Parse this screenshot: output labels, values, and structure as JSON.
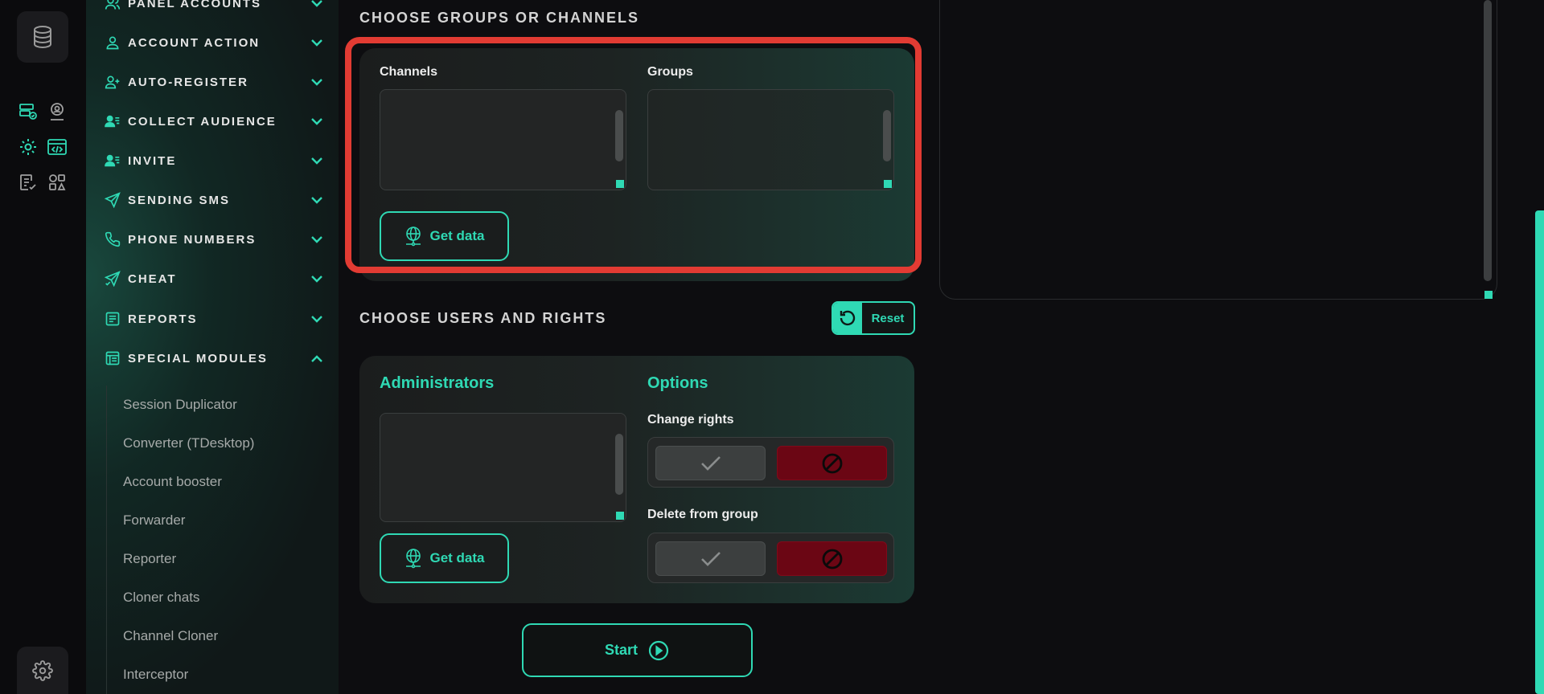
{
  "sidebar": {
    "items": [
      {
        "label": "PANEL ACCOUNTS",
        "icon": "users-icon",
        "expanded": false
      },
      {
        "label": "ACCOUNT ACTION",
        "icon": "user-icon",
        "expanded": false
      },
      {
        "label": "AUTO-REGISTER",
        "icon": "user-plus-icon",
        "expanded": false
      },
      {
        "label": "COLLECT AUDIENCE",
        "icon": "user-list-icon",
        "expanded": false
      },
      {
        "label": "INVITE",
        "icon": "user-list-icon",
        "expanded": false
      },
      {
        "label": "SENDING SMS",
        "icon": "send-icon",
        "expanded": false
      },
      {
        "label": "PHONE NUMBERS",
        "icon": "phone-icon",
        "expanded": false
      },
      {
        "label": "CHEAT",
        "icon": "send-check-icon",
        "expanded": false
      },
      {
        "label": "REPORTS",
        "icon": "report-icon",
        "expanded": false
      },
      {
        "label": "SPECIAL MODULES",
        "icon": "modules-icon",
        "expanded": true
      }
    ],
    "subitems": [
      "Session Duplicator",
      "Converter (TDesktop)",
      "Account booster",
      "Forwarder",
      "Reporter",
      "Cloner chats",
      "Channel Cloner",
      "Interceptor"
    ]
  },
  "groups_section": {
    "title": "CHOOSE GROUPS OR CHANNELS",
    "channels_label": "Channels",
    "groups_label": "Groups",
    "get_data_label": "Get data"
  },
  "users_section": {
    "title": "CHOOSE USERS AND RIGHTS",
    "reset_label": "Reset",
    "administrators_label": "Administrators",
    "options_label": "Options",
    "change_rights_label": "Change rights",
    "delete_from_group_label": "Delete from group",
    "get_data_label": "Get data"
  },
  "start_label": "Start",
  "colors": {
    "accent": "#2fd9b4",
    "danger": "#6b0614",
    "highlight": "#e23b33"
  }
}
